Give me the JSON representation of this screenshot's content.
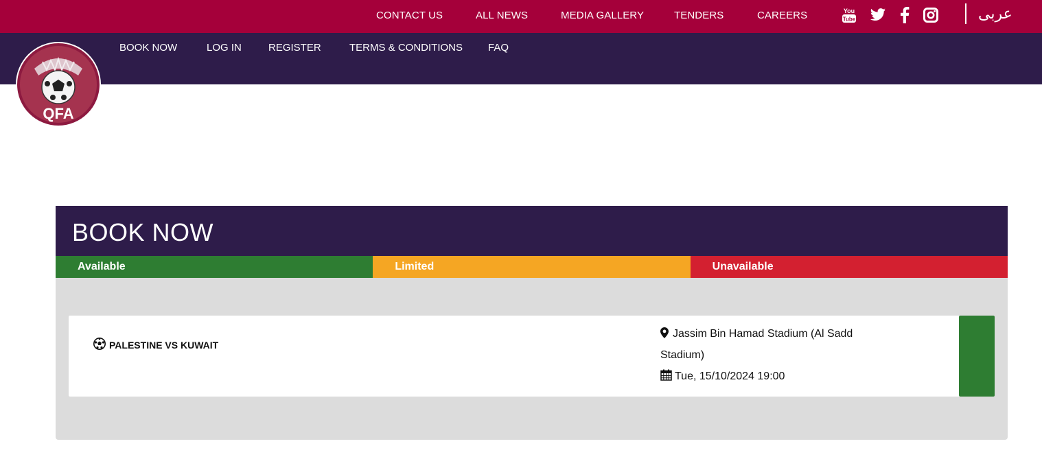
{
  "top_nav": {
    "items": [
      "CONTACT US",
      "ALL NEWS",
      "MEDIA GALLERY",
      "TENDERS",
      "CAREERS"
    ],
    "social_icons": [
      "youtube-icon",
      "twitter-icon",
      "facebook-icon",
      "instagram-icon"
    ],
    "language": "عربى"
  },
  "sub_nav": {
    "items": [
      "BOOK NOW",
      "LOG IN",
      "REGISTER",
      "TERMS & CONDITIONS",
      "FAQ"
    ]
  },
  "logo": {
    "text": "QFA"
  },
  "book": {
    "title": "BOOK NOW",
    "legend": [
      "Available",
      "Limited",
      "Unavailable"
    ],
    "match": {
      "name": "PALESTINE VS KUWAIT",
      "venue": "Jassim Bin Hamad Stadium (Al Sadd Stadium)",
      "date": "Tue, 15/10/2024 19:00",
      "status": "Available"
    }
  },
  "colors": {
    "top_bar": "#a5003a",
    "nav_purple": "#2e1c4a",
    "available": "#2e7d32",
    "limited": "#f5a623",
    "unavailable": "#d32030"
  }
}
